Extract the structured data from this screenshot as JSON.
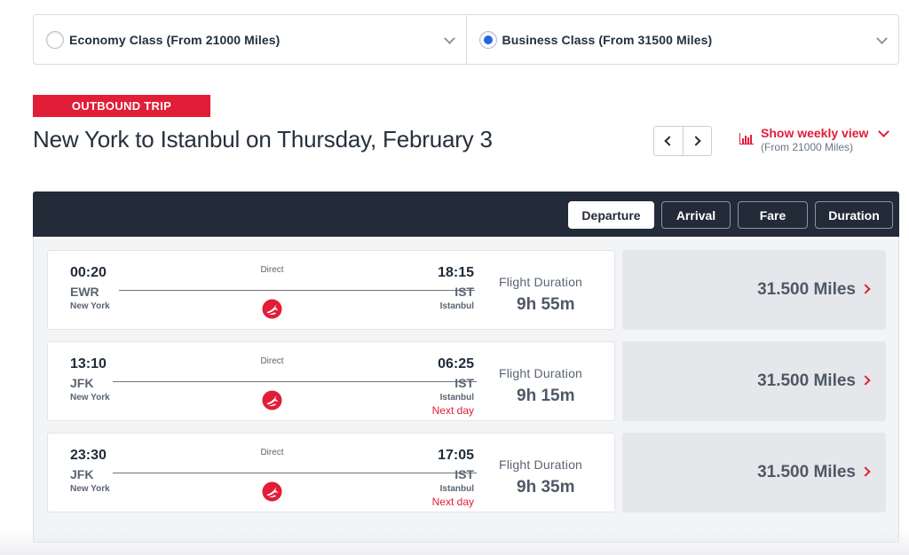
{
  "cabins": [
    {
      "label": "Economy Class (From 21000 Miles)",
      "selected": false
    },
    {
      "label": "Business Class (From 31500 Miles)",
      "selected": true
    }
  ],
  "trip_badge": "OUTBOUND TRIP",
  "route_title": "New York to Istanbul on Thursday, February 3",
  "weekly_view": {
    "title": "Show weekly view",
    "subtitle": "(From 21000 Miles)"
  },
  "sort": {
    "options": [
      "Departure",
      "Arrival",
      "Fare",
      "Duration"
    ],
    "active": "Departure"
  },
  "duration_label": "Flight Duration",
  "flights": [
    {
      "dep_time": "00:20",
      "dep_code": "EWR",
      "dep_city": "New York",
      "stops": "Direct",
      "arr_time": "18:15",
      "arr_code": "IST",
      "arr_city": "Istanbul",
      "next_day": "",
      "duration": "9h 55m",
      "price": "31.500 Miles"
    },
    {
      "dep_time": "13:10",
      "dep_code": "JFK",
      "dep_city": "New York",
      "stops": "Direct",
      "arr_time": "06:25",
      "arr_code": "IST",
      "arr_city": "Istanbul",
      "next_day": "Next day",
      "duration": "9h 15m",
      "price": "31.500 Miles"
    },
    {
      "dep_time": "23:30",
      "dep_code": "JFK",
      "dep_city": "New York",
      "stops": "Direct",
      "arr_time": "17:05",
      "arr_code": "IST",
      "arr_city": "Istanbul",
      "next_day": "Next day",
      "duration": "9h 35m",
      "price": "31.500 Miles"
    }
  ],
  "colors": {
    "brand_red": "#e21d38",
    "sort_bar": "#232b38",
    "radio_selected": "#1f66e5"
  },
  "icons": {
    "airline_logo": "turkish-airlines-logo-icon",
    "weekly": "bar-chart-icon"
  }
}
